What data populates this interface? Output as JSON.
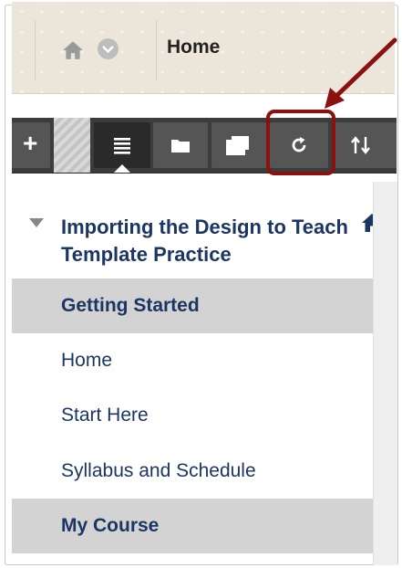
{
  "breadcrumb": {
    "home_label": "Home",
    "home_icon": "home-icon",
    "menu_icon": "chevron-down-icon"
  },
  "toolbar": {
    "buttons": [
      {
        "name": "add-menu-item-button",
        "icon": "plus-icon",
        "glyph": "+"
      },
      {
        "name": "course-menu-view-button",
        "icon": "list-icon",
        "glyph": "≣",
        "active": true
      },
      {
        "name": "folder-view-button",
        "icon": "folder-icon"
      },
      {
        "name": "new-window-button",
        "icon": "window-icon"
      },
      {
        "name": "refresh-button",
        "icon": "refresh-icon",
        "glyph": "↻",
        "highlighted": true
      },
      {
        "name": "reorder-button",
        "icon": "sort-arrows-icon",
        "glyph": "⇅"
      }
    ]
  },
  "course": {
    "title": "Importing the Design to Teach Template Practice",
    "title_icon": "home-icon"
  },
  "menu": {
    "items": [
      {
        "label": "Getting Started",
        "type": "header"
      },
      {
        "label": "Home",
        "type": "link"
      },
      {
        "label": "Start Here",
        "type": "link"
      },
      {
        "label": "Syllabus and Schedule",
        "type": "link"
      },
      {
        "label": "My Course",
        "type": "header"
      }
    ]
  },
  "colors": {
    "course_text": "#1c3664",
    "annotation": "#8b1111",
    "toolbar": "#3c3c3c"
  }
}
